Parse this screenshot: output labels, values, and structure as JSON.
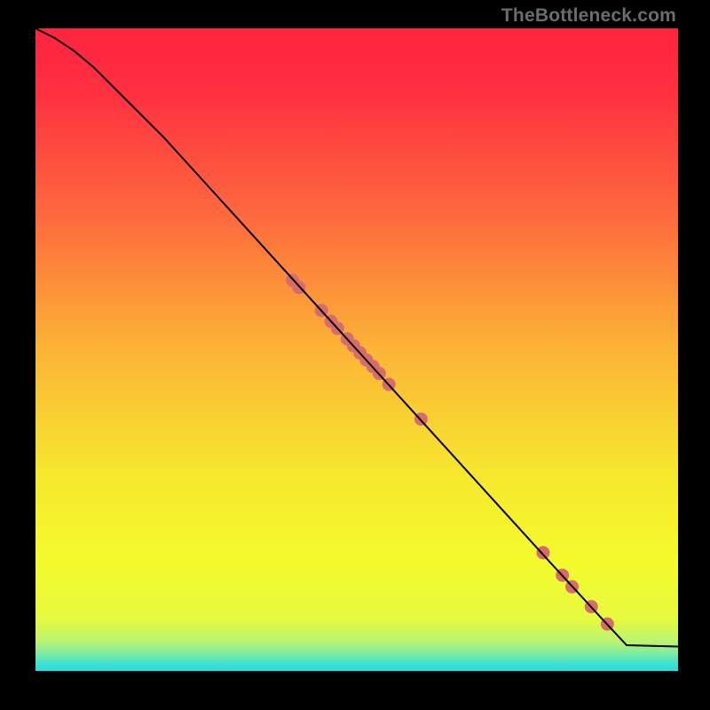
{
  "attribution": "TheBottleneck.com",
  "chart_data": {
    "type": "line",
    "title": "",
    "xlabel": "",
    "ylabel": "",
    "xlim": [
      0,
      100
    ],
    "ylim": [
      0,
      100
    ],
    "grid": false,
    "legend": false,
    "gradient_stops": [
      {
        "pos": 0.0,
        "color": "#ff233f"
      },
      {
        "pos": 0.1,
        "color": "#ff3040"
      },
      {
        "pos": 0.3,
        "color": "#fe6c3d"
      },
      {
        "pos": 0.5,
        "color": "#fcb436"
      },
      {
        "pos": 0.7,
        "color": "#f6e92d"
      },
      {
        "pos": 0.83,
        "color": "#f4fb2c"
      },
      {
        "pos": 0.92,
        "color": "#e6fa3f"
      },
      {
        "pos": 0.955,
        "color": "#b8f473"
      },
      {
        "pos": 0.975,
        "color": "#77eaa7"
      },
      {
        "pos": 0.99,
        "color": "#3be0d3"
      },
      {
        "pos": 1.0,
        "color": "#26dde2"
      }
    ],
    "series": [
      {
        "name": "curve",
        "type": "line",
        "color": "#000000",
        "x": [
          0,
          3,
          6,
          9,
          12,
          15,
          20,
          30,
          40,
          50,
          60,
          70,
          80,
          88,
          92,
          100
        ],
        "y": [
          100,
          98.5,
          96.5,
          94,
          91,
          88,
          83,
          72,
          61,
          50,
          39,
          28,
          17,
          8.3,
          4,
          3.8
        ]
      },
      {
        "name": "marked-points",
        "type": "scatter",
        "color": "#d86b6c",
        "radius": 7.5,
        "x": [
          40.0,
          41.0,
          44.5,
          46.0,
          47.0,
          48.5,
          49.5,
          50.5,
          51.5,
          52.5,
          53.5,
          55.0,
          60.0,
          79.0,
          82.0,
          83.5,
          86.5,
          89.0
        ],
        "y": [
          60.8,
          59.7,
          56.1,
          54.4,
          53.3,
          51.7,
          50.6,
          49.5,
          48.4,
          47.4,
          46.3,
          44.6,
          39.2,
          18.4,
          14.9,
          13.1,
          10.0,
          7.3
        ]
      }
    ]
  }
}
